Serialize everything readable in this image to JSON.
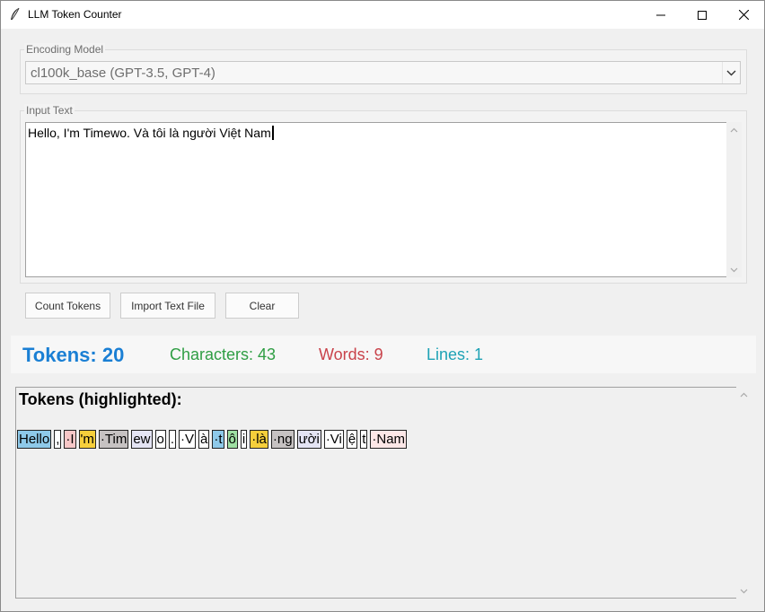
{
  "window": {
    "title": "LLM Token Counter",
    "icon": "feather-icon"
  },
  "encoding": {
    "label": "Encoding Model",
    "selected": "cl100k_base (GPT-3.5, GPT-4)"
  },
  "input": {
    "label": "Input Text",
    "value": "Hello, I'm Timewo. Và tôi là người Việt Nam"
  },
  "buttons": {
    "count": "Count Tokens",
    "import": "Import Text File",
    "clear": "Clear"
  },
  "stats": {
    "tokens": "Tokens: 20",
    "characters": "Characters: 43",
    "words": "Words: 9",
    "lines": "Lines: 1",
    "colors": {
      "tokens": "#1a7fd4",
      "characters": "#2f9e44",
      "words": "#c9434b",
      "lines": "#1ea2b5"
    }
  },
  "output": {
    "heading": "Tokens (highlighted):",
    "tokens": [
      {
        "text": "Hello",
        "color": "#8ec9e9"
      },
      {
        "text": ",",
        "color": "#ffffff"
      },
      {
        "text": " I",
        "color": "#f7c7c7"
      },
      {
        "text": "'m",
        "color": "#f6cf3b"
      },
      {
        "text": " Tim",
        "color": "#c6c2c2"
      },
      {
        "text": "ew",
        "color": "#e4e4f4"
      },
      {
        "text": "o",
        "color": "#ffffff"
      },
      {
        "text": ".",
        "color": "#ffffff"
      },
      {
        "text": " V",
        "color": "#ffffff"
      },
      {
        "text": "à",
        "color": "#ffffff"
      },
      {
        "text": " t",
        "color": "#8ec9e9"
      },
      {
        "text": "ô",
        "color": "#9edfa2"
      },
      {
        "text": "i",
        "color": "#ffffff"
      },
      {
        "text": " là",
        "color": "#f6cf3b"
      },
      {
        "text": " ng",
        "color": "#c6c2c2"
      },
      {
        "text": "ười",
        "color": "#e4e4f4"
      },
      {
        "text": " Vi",
        "color": "#ffffff"
      },
      {
        "text": "ệ",
        "color": "#ffffff"
      },
      {
        "text": "t",
        "color": "#ffffff"
      },
      {
        "text": " Nam",
        "color": "#fde7e7"
      }
    ]
  }
}
